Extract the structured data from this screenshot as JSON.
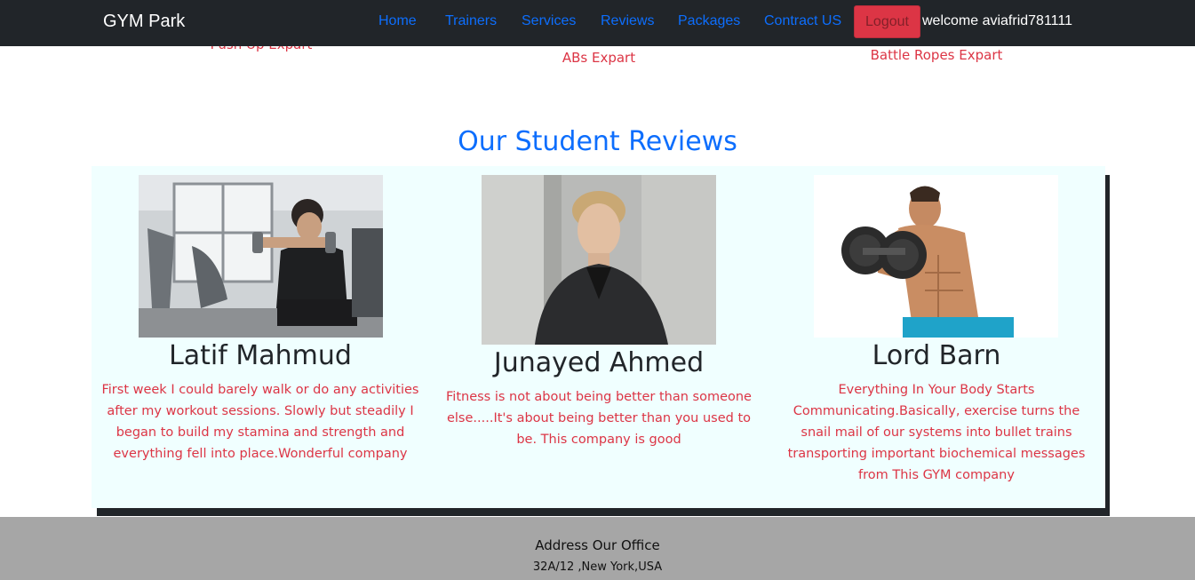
{
  "navbar": {
    "brand": "GYM Park",
    "links": [
      "Home",
      "Trainers",
      "Services",
      "Reviews",
      "Packages",
      "Contract US"
    ],
    "logout_label": "Logout",
    "welcome": "welcome aviafrid781111"
  },
  "trainers": {
    "titles": [
      "Push Up Expart",
      "ABs Expart",
      "Battle Ropes Expart"
    ]
  },
  "reviews": {
    "heading": "Our Student Reviews",
    "items": [
      {
        "name": "Latif Mahmud",
        "text": "First week I could barely walk or do any activities after my workout sessions. Slowly but steadily I began to build my stamina and strength and everything fell into place.Wonderful company"
      },
      {
        "name": "Junayed Ahmed",
        "text": "Fitness is not about being better than someone else.....It's about being better than you used to be. This company is good"
      },
      {
        "name": "Lord Barn",
        "text": "Everything In Your Body Starts Communicating.Basically, exercise turns the snail mail of our systems into bullet trains transporting important biochemical messages from This GYM company"
      }
    ]
  },
  "footer": {
    "title": "Address Our Office",
    "address": "32A/12 ,New York,USA"
  },
  "colors": {
    "navbar_bg": "#212529",
    "link": "#0d6efd",
    "danger": "#dc3545",
    "panel_bg": "#f0ffff",
    "footer_bg": "#a6a6a6"
  }
}
